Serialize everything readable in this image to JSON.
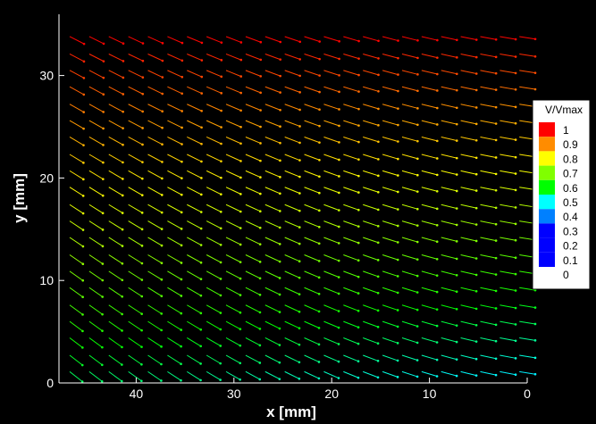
{
  "chart_data": {
    "type": "vector-field",
    "title": "",
    "xlabel": "x [mm]",
    "ylabel": "y [mm]",
    "x_axis": {
      "min": 0,
      "max": 47.5,
      "reversed": true,
      "ticks": [
        40,
        30,
        20,
        10,
        0
      ]
    },
    "y_axis": {
      "min": 0,
      "max": 36,
      "ticks": [
        0,
        10,
        20,
        30
      ]
    },
    "grid": false,
    "background": "#000000",
    "colorbar": {
      "title": "V/Vmax",
      "position": "right",
      "levels": [
        {
          "label": "1",
          "value": 1.0,
          "color": "#ff0000"
        },
        {
          "label": "0.9",
          "value": 0.9,
          "color": "#ff8c00"
        },
        {
          "label": "0.8",
          "value": 0.8,
          "color": "#ffff00"
        },
        {
          "label": "0.7",
          "value": 0.7,
          "color": "#80ff00"
        },
        {
          "label": "0.6",
          "value": 0.6,
          "color": "#00ff00"
        },
        {
          "label": "0.5",
          "value": 0.5,
          "color": "#00ffff"
        },
        {
          "label": "0.4",
          "value": 0.4,
          "color": "#0080ff"
        },
        {
          "label": "0.3",
          "value": 0.3,
          "color": "#0000ff"
        },
        {
          "label": "0.2",
          "value": 0.2,
          "color": "#0000ff"
        },
        {
          "label": "0.1",
          "value": 0.1,
          "color": "#0000ff"
        },
        {
          "label": "0",
          "value": 0.0,
          "color": "#0000ff"
        }
      ]
    },
    "grid_points": {
      "x": [
        46.8,
        44.8,
        42.8,
        40.8,
        38.8,
        36.8,
        34.8,
        32.8,
        30.8,
        28.8,
        26.8,
        24.8,
        22.8,
        20.8,
        18.8,
        16.8,
        14.8,
        12.8,
        10.8,
        8.8,
        6.8,
        4.8,
        2.8,
        0.8
      ],
      "y": [
        1.1,
        2.7,
        4.4,
        6.0,
        7.6,
        9.3,
        10.9,
        12.5,
        14.2,
        15.8,
        17.4,
        19.1,
        20.7,
        22.3,
        24.0,
        25.6,
        27.2,
        28.9,
        30.5,
        32.1,
        33.8
      ]
    },
    "field_description": "vectors point toward -x (right) and -y; magnitude V/Vmax ~1 near the top, decreasing toward ~0.5 at the bottom right"
  }
}
